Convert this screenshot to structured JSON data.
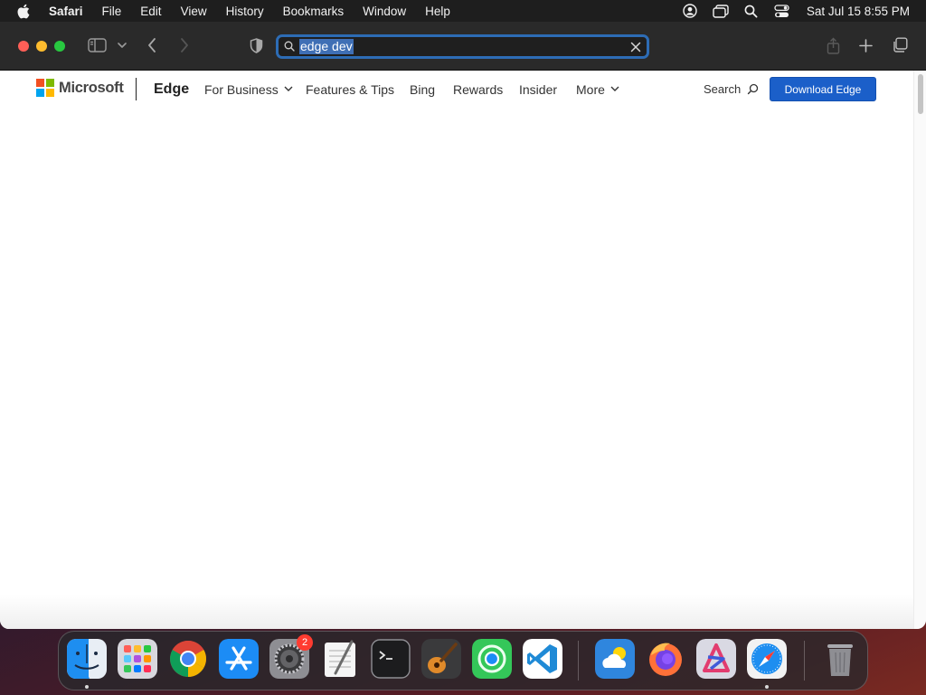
{
  "menubar": {
    "app_name": "Safari",
    "items": [
      "File",
      "Edit",
      "View",
      "History",
      "Bookmarks",
      "Window",
      "Help"
    ],
    "clock": "Sat Jul 15  8:55 PM"
  },
  "browser": {
    "url_text": "edge dev"
  },
  "site": {
    "logo_text": "Microsoft",
    "brand": "Edge",
    "nav": [
      "For Business",
      "Features & Tips",
      "Bing",
      "Rewards",
      "Insider",
      "More"
    ],
    "search_label": "Search",
    "download_label": "Download Edge",
    "logo_colors": [
      "#f25022",
      "#7fba00",
      "#00a4ef",
      "#ffb900"
    ],
    "accent": "#1b5fc9"
  },
  "dock": {
    "apps": [
      "finder",
      "launchpad",
      "chrome",
      "app-store",
      "system-settings",
      "textedit",
      "terminal",
      "garageband",
      "find-my",
      "vscode",
      "weather",
      "firefox",
      "affinity",
      "safari",
      "trash"
    ],
    "settings_badge": "2"
  }
}
